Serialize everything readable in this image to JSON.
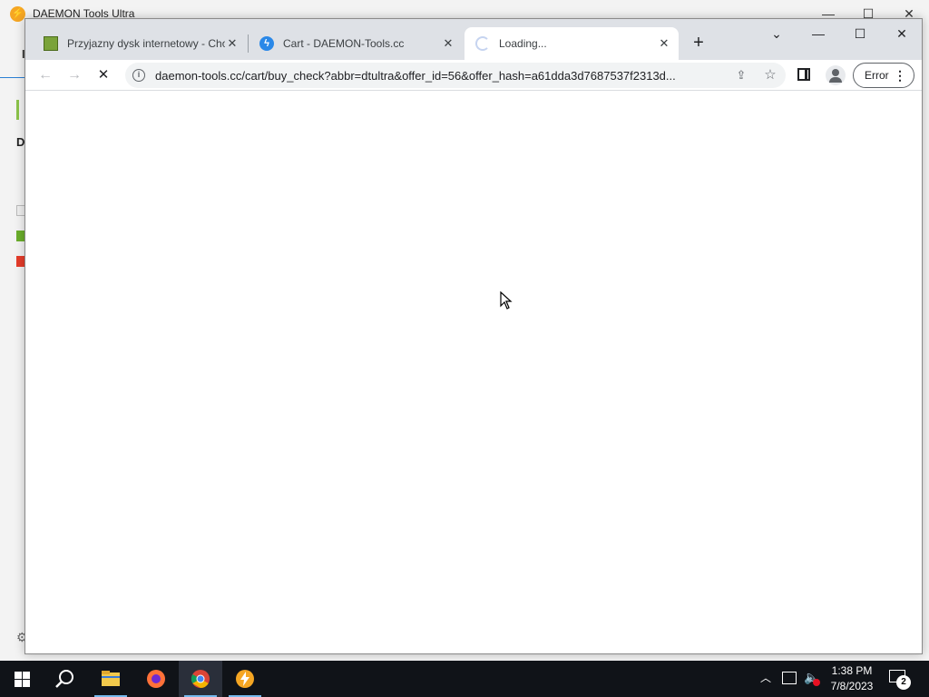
{
  "background_app": {
    "title": "DAEMON Tools Ultra",
    "logo_glyph": "⚡",
    "sidebar_letter_top": "I",
    "sidebar_letter": "D"
  },
  "browser": {
    "tabs": [
      {
        "title": "Przyjazny dysk internetowy - Chomikuj.pl",
        "icon": "chomikuj-favicon"
      },
      {
        "title": "Cart - DAEMON-Tools.cc",
        "icon": "daemon-tools-favicon"
      },
      {
        "title": "Loading...",
        "icon": "loading-spinner-icon",
        "active": true
      }
    ],
    "url": "daemon-tools.cc/cart/buy_check?abbr=dtultra&offer_id=56&offer_hash=a61dda3d7687537f2313d...",
    "error_button_label": "Error",
    "new_tab_glyph": "+"
  },
  "taskbar": {
    "clock_time": "1:38 PM",
    "clock_date": "7/8/2023",
    "notification_count": "2"
  }
}
